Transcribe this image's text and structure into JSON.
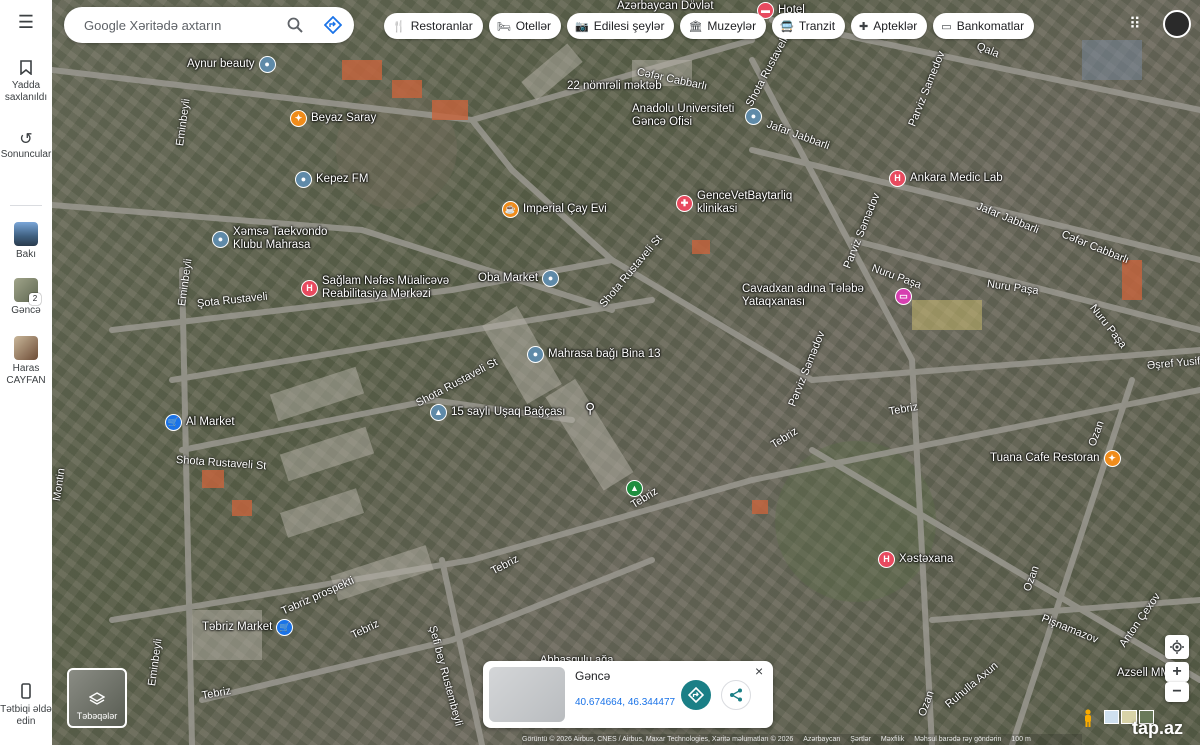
{
  "search": {
    "placeholder": "Google Xəritədə axtarın"
  },
  "chips": [
    {
      "icon": "restaurant-icon",
      "label": "Restoranlar"
    },
    {
      "icon": "hotel-icon",
      "label": "Otellər"
    },
    {
      "icon": "camera-icon",
      "label": "Edilesi şeylər"
    },
    {
      "icon": "museum-icon",
      "label": "Muzeylər"
    },
    {
      "icon": "transit-icon",
      "label": "Tranzit"
    },
    {
      "icon": "pharmacy-icon",
      "label": "Apteklər"
    },
    {
      "icon": "atm-icon",
      "label": "Bankomatlar"
    }
  ],
  "rail": {
    "saved": "Yadda saxlanıldı",
    "recent": "Sonuncular",
    "baku": "Bakı",
    "ganja": "Gəncə",
    "ganja_badge": "2",
    "haras": "Haras CAYFAN",
    "get_app": "Tətbiqi əldə edin"
  },
  "layers": {
    "label": "Təbəqələr"
  },
  "card": {
    "title": "Gəncə",
    "coords": "40.674664, 46.344477"
  },
  "pois": [
    {
      "id": "aynur",
      "label": "Aynur beauty",
      "color": "#5f8aa8"
    },
    {
      "id": "beyaz",
      "label": "Beyaz Saray",
      "color": "#f08c1b"
    },
    {
      "id": "kepez",
      "label": "Kepez FM",
      "color": "#5f8aa8"
    },
    {
      "id": "xemse",
      "label": "Xəmsə Taekvondo Klubu Mahrasa",
      "color": "#5f8aa8"
    },
    {
      "id": "imperial",
      "label": "Imperial Çay Evi",
      "color": "#f08c1b"
    },
    {
      "id": "saglam",
      "label": "Sağlam Nəfəs Müalicəvə Reabilitasiya Mərkəzi",
      "color": "#e84a5f"
    },
    {
      "id": "oba",
      "label": "Oba Market",
      "color": "#5f8aa8"
    },
    {
      "id": "mektab",
      "label": "22 nömrəli məktəb",
      "color": "#5f8aa8"
    },
    {
      "id": "anadolu",
      "label": "Anadolu Universiteti Gəncə Ofisi",
      "color": "#5f8aa8"
    },
    {
      "id": "vet",
      "label": "GenceVetBaytarliq klinikasi",
      "color": "#e84a5f"
    },
    {
      "id": "ankara",
      "label": "Ankara Medic Lab",
      "color": "#e84a5f"
    },
    {
      "id": "cavad",
      "label": "Cavadxan adına Tələbə Yataqxanası",
      "color": "#d63fb0"
    },
    {
      "id": "mahrasa",
      "label": "Mahrasa bağı Bina 13",
      "color": "#5f8aa8"
    },
    {
      "id": "usaq",
      "label": "15 saylı Uşaq Bağçası",
      "color": "#5f8aa8"
    },
    {
      "id": "almarket",
      "label": "Al Market",
      "color": "#1a73e8"
    },
    {
      "id": "tuana",
      "label": "Tuana Cafe Restoran",
      "color": "#f08c1b"
    },
    {
      "id": "xestexana",
      "label": "Xəstəxana",
      "color": "#e84a5f"
    },
    {
      "id": "tebrizmarket",
      "label": "Təbriz Market",
      "color": "#1a73e8"
    },
    {
      "id": "azersell",
      "label": "Azsell MM",
      "color": "#5f8aa8"
    },
    {
      "id": "dovlet",
      "label": "Azərbaycan Dövlət",
      "color": "#5f8aa8"
    },
    {
      "id": "hotel",
      "label": "Hotel",
      "color": "#e84a5f"
    }
  ],
  "roads": {
    "cafer": "Cəfər Cabbarlı",
    "shota1": "Shota Rustaveli St",
    "jafar1": "Jafar Jabbarli",
    "jafar2": "Jafar Jabbarli",
    "jafar3": "Cəfər Cabbarlı",
    "qala": "Qala",
    "parviz1": "Parviz Samedov",
    "parviz2": "Parviz Səmədov",
    "parviz3": "Pərviz Səmədov",
    "nuru1": "Nuru Paşa",
    "nuru2": "Nuru Paşa",
    "nuru3": "Nuru Paşa",
    "shota2": "Shota Rustaveli St",
    "shota3": "Şota Rustaveli",
    "shota4": "Shota Rustaveli St",
    "shota5": "Shota Rustaveli St",
    "tebriz1": "Tebriz",
    "tebriz2": "Tebriz",
    "tebriz3": "Tebriz",
    "tebriz4": "Tebriz",
    "tebriz5": "Tebriz",
    "tebrizprosp": "Təbriz prospekti",
    "tebriz6": "Tebriz",
    "emin1": "Eminbeyli",
    "emin2": "Eminbeyli",
    "emin3": "Eminbeyli",
    "montin": "Montin",
    "sefibey": "Şefi bey Rustembeyli",
    "ozan1": "Ozan",
    "ozan2": "Ozan",
    "ozan3": "Ozan",
    "pishnamazov": "Pişnamazov",
    "anton": "Anton Çexov",
    "ruhulla": "Ruhulla Axun",
    "esref": "Əşref Yusifz",
    "abbasqulu": "Abbasqulu ağa"
  },
  "footer": {
    "credits": "Görüntü © 2026 Airbus, CNES / Airbus, Maxar Technologies, Xəritə məlumatları © 2026",
    "country": "Azərbaycan",
    "terms": "Şərtlər",
    "privacy": "Məxfilik",
    "feedback": "Məhsul barədə rəy göndərin",
    "scale": "100 m"
  },
  "watermark": "tap.az"
}
